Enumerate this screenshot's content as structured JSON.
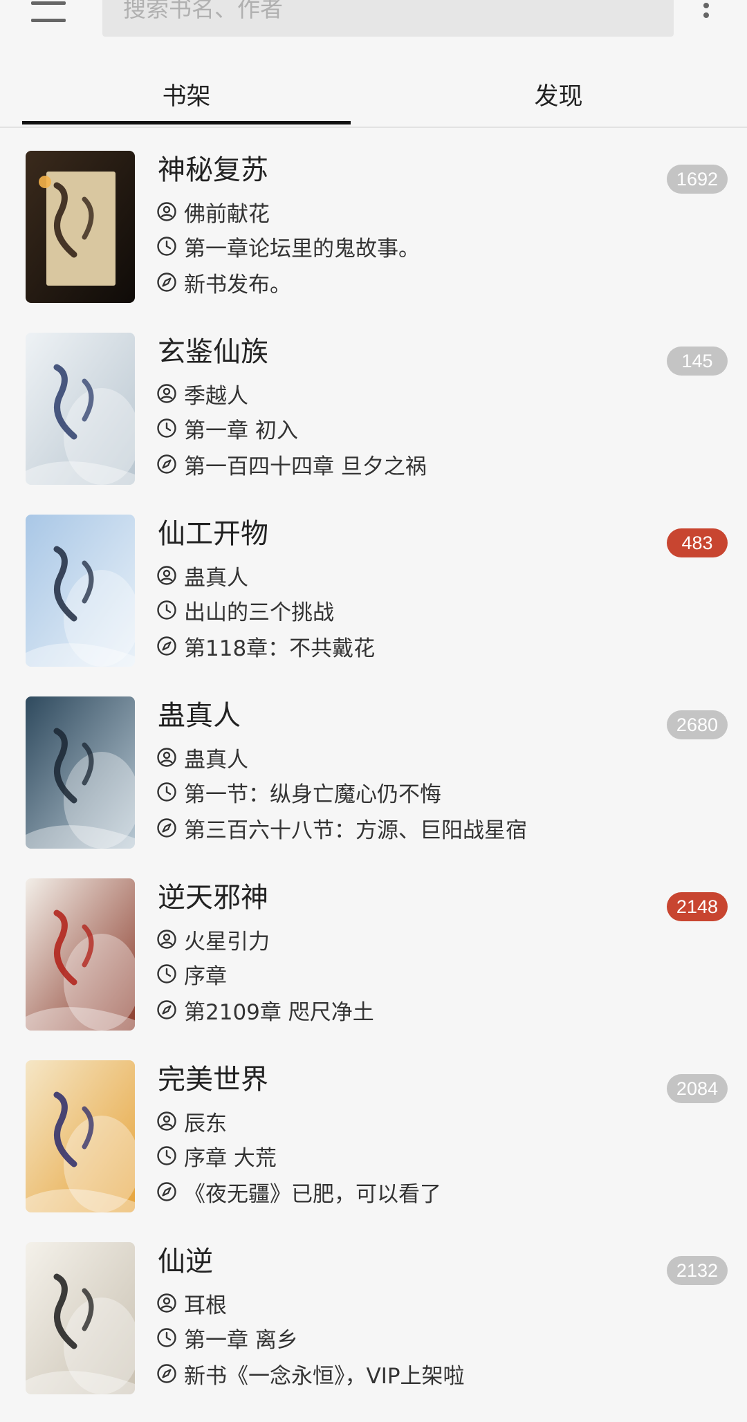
{
  "search": {
    "placeholder": "搜索书名、作者"
  },
  "tabs": [
    {
      "label": "书架",
      "active": true
    },
    {
      "label": "发现",
      "active": false
    }
  ],
  "colors": {
    "badge_grey": "#c4c4c4",
    "badge_red": "#c84530"
  },
  "books": [
    {
      "title": "神秘复苏",
      "author": "佛前献花",
      "read_chapter": "第一章论坛里的鬼故事。",
      "latest_chapter": "新书发布。",
      "unread": "1692",
      "highlight": false
    },
    {
      "title": "玄鉴仙族",
      "author": "季越人",
      "read_chapter": "第一章 初入",
      "latest_chapter": "第一百四十四章 旦夕之祸",
      "unread": "145",
      "highlight": false
    },
    {
      "title": "仙工开物",
      "author": "蛊真人",
      "read_chapter": "出山的三个挑战",
      "latest_chapter": "第118章：不共戴花",
      "unread": "483",
      "highlight": true
    },
    {
      "title": "蛊真人",
      "author": "蛊真人",
      "read_chapter": "第一节：纵身亡魔心仍不悔",
      "latest_chapter": "第三百六十八节：方源、巨阳战星宿",
      "unread": "2680",
      "highlight": false
    },
    {
      "title": "逆天邪神",
      "author": "火星引力",
      "read_chapter": "序章",
      "latest_chapter": "第2109章 咫尺净土",
      "unread": "2148",
      "highlight": true
    },
    {
      "title": "完美世界",
      "author": "辰东",
      "read_chapter": "序章 大荒",
      "latest_chapter": "《夜无疆》已肥，可以看了",
      "unread": "2084",
      "highlight": false
    },
    {
      "title": "仙逆",
      "author": "耳根",
      "read_chapter": "第一章 离乡",
      "latest_chapter": "新书《一念永恒》，VIP上架啦",
      "unread": "2132",
      "highlight": false
    }
  ],
  "icons": {
    "author": "person-icon",
    "read": "clock-icon",
    "latest": "compass-icon",
    "menu": "hamburger-icon",
    "more": "more-vertical-icon"
  }
}
